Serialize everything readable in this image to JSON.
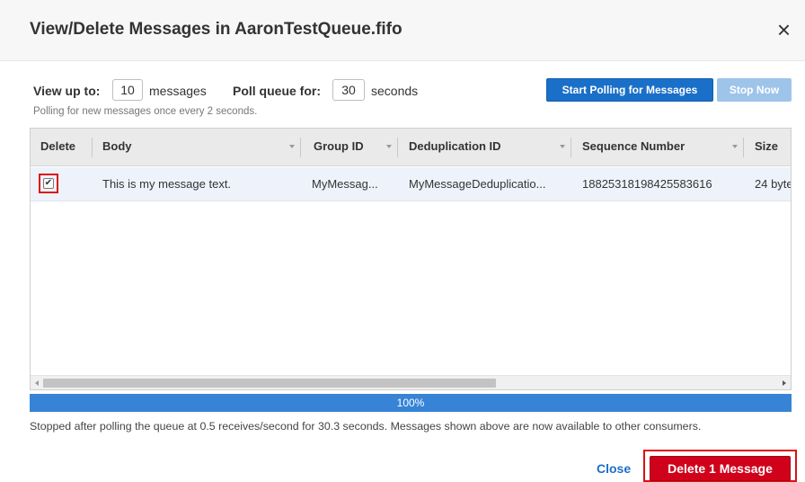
{
  "dialog": {
    "title": "View/Delete Messages in AaronTestQueue.fifo",
    "close_glyph": "×"
  },
  "controls": {
    "view_up_to_label": "View up to:",
    "view_up_to_value": "10",
    "view_up_to_unit": "messages",
    "poll_label": "Poll queue for:",
    "poll_value": "30",
    "poll_unit": "seconds",
    "hint": "Polling for new messages once every 2 seconds.",
    "start_button": "Start Polling for Messages",
    "stop_button": "Stop Now"
  },
  "table": {
    "columns": [
      "Delete",
      "Body",
      "Group ID",
      "Deduplication ID",
      "Sequence Number",
      "Size"
    ],
    "rows": [
      {
        "checked": true,
        "check_glyph": "✔",
        "body": "This is my message text.",
        "group_id": "MyMessag...",
        "dedup_id": "MyMessageDeduplicatio...",
        "sequence": "18825318198425583616",
        "size": "24 byte"
      }
    ]
  },
  "progress": {
    "percent": 100,
    "label": "100%"
  },
  "status_text": "Stopped after polling the queue at 0.5 receives/second for 30.3 seconds. Messages shown above are now available to other consumers.",
  "footer": {
    "close_link": "Close",
    "delete_button": "Delete 1 Message"
  },
  "colors": {
    "primary_blue": "#1a6fc8",
    "disabled_blue": "#9fc4ea",
    "progress_blue": "#3784d6",
    "danger_red": "#d0021b",
    "highlight_red": "#dd1111"
  },
  "icons": {
    "close": "close-icon",
    "sort": "sort-caret-down-icon",
    "checkbox": "checkbox-checked-icon"
  }
}
